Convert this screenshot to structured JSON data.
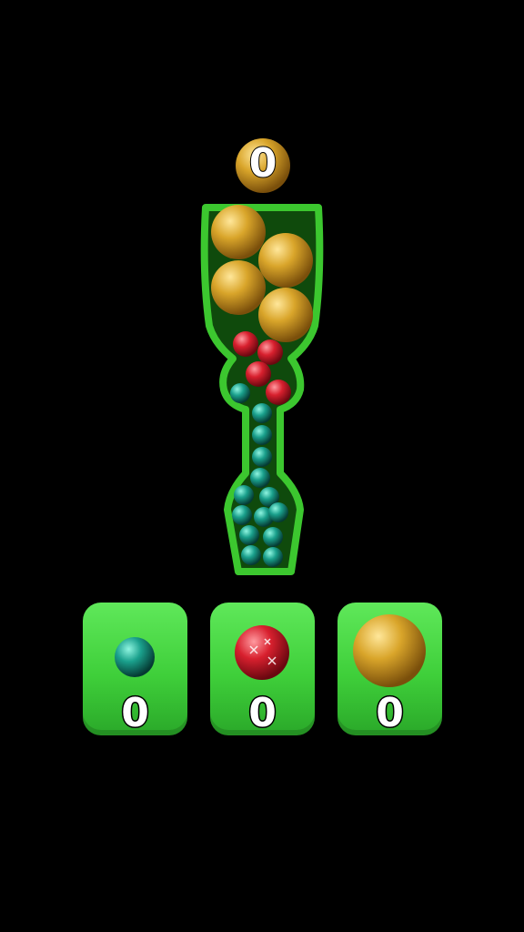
{
  "top_counter": {
    "value": "0",
    "ball_type": "gold-ball"
  },
  "bins": [
    {
      "ball_type": "teal-ball",
      "count": "0"
    },
    {
      "ball_type": "red-ball",
      "count": "0"
    },
    {
      "ball_type": "gold-ball",
      "count": "0"
    }
  ],
  "colors": {
    "background": "#000000",
    "container_fill": "#0f4a0c",
    "container_stroke": "#3cc72f",
    "bin_green": "#4ad944",
    "gold": "#d9a52a",
    "red": "#d8202e",
    "teal": "#1aa08c"
  }
}
